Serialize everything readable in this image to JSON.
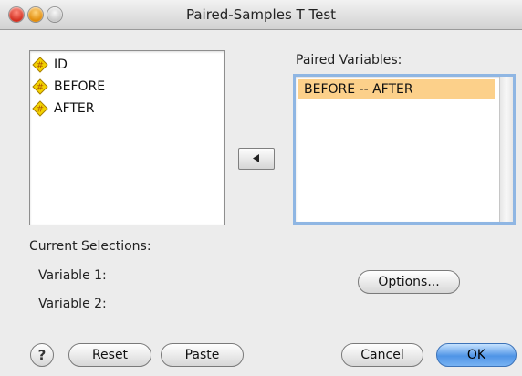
{
  "window": {
    "title": "Paired-Samples T Test"
  },
  "source_variables": [
    "ID",
    "BEFORE",
    "AFTER"
  ],
  "paired": {
    "label": "Paired Variables:",
    "items": [
      "BEFORE -- AFTER"
    ]
  },
  "selections": {
    "heading": "Current Selections:",
    "variable1_label": "Variable 1:",
    "variable2_label": "Variable 2:"
  },
  "buttons": {
    "options": "Options...",
    "reset": "Reset",
    "paste": "Paste",
    "cancel": "Cancel",
    "ok": "OK",
    "help": "?"
  },
  "colors": {
    "selected_row": "#fcd08a",
    "focus_ring": "#8fb6e3",
    "default_button": "#4f94e6",
    "variable_icon": "#f4d300"
  },
  "icons": {
    "variable": "numeric-variable-icon",
    "move": "arrow-left-icon",
    "help": "help-icon"
  }
}
